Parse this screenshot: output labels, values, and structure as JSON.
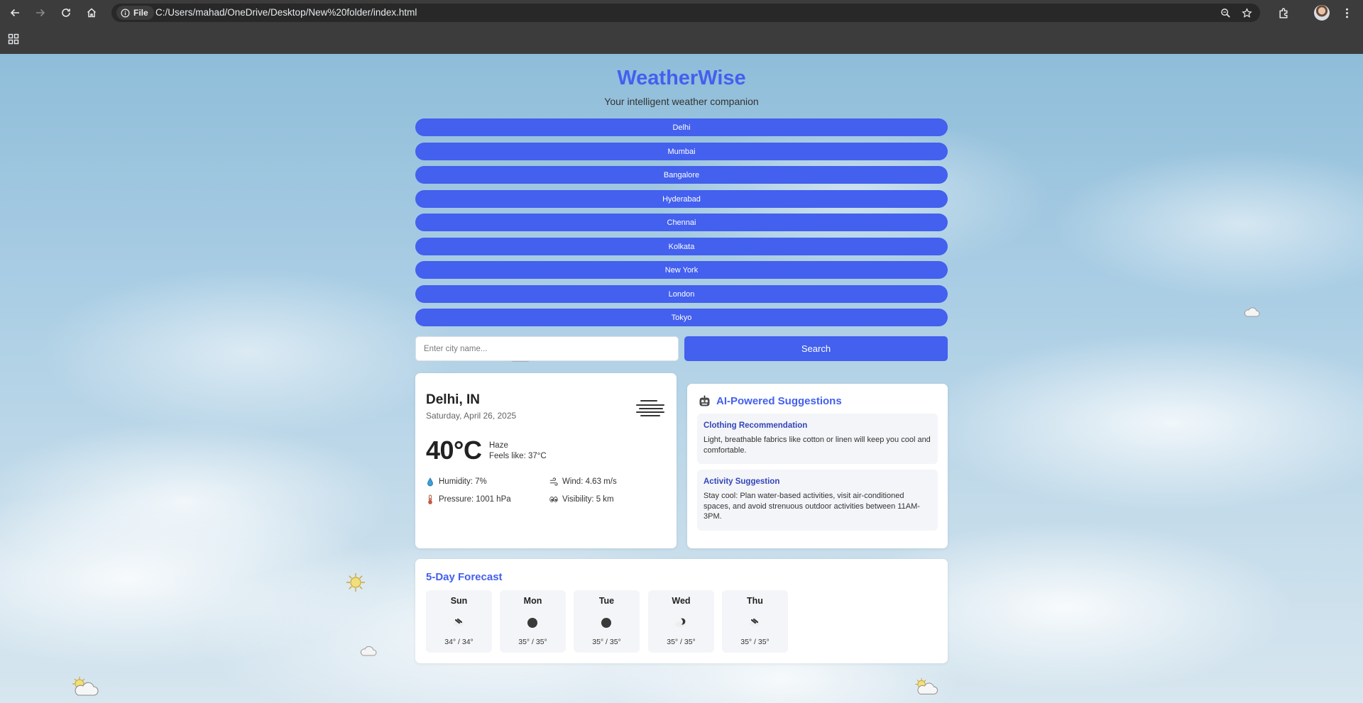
{
  "browser": {
    "url": "C:/Users/mahad/OneDrive/Desktop/New%20folder/index.html",
    "site_chip_label": "File"
  },
  "app": {
    "title": "WeatherWise",
    "subtitle": "Your intelligent weather companion"
  },
  "cities": [
    "Delhi",
    "Mumbai",
    "Bangalore",
    "Hyderabad",
    "Chennai",
    "Kolkata",
    "New York",
    "London",
    "Tokyo"
  ],
  "search": {
    "placeholder": "Enter city name...",
    "value": "",
    "button_label": "Search"
  },
  "current": {
    "location": "Delhi, IN",
    "date": "Saturday, April 26, 2025",
    "temperature": "40°C",
    "condition": "Haze",
    "feels_like": "Feels like: 37°C",
    "condition_icon": "haze-icon",
    "humidity": "Humidity: 7%",
    "wind": "Wind: 4.63 m/s",
    "pressure": "Pressure: 1001 hPa",
    "visibility": "Visibility: 5 km"
  },
  "ai": {
    "title": "AI-Powered Suggestions",
    "suggestions": [
      {
        "title": "Clothing Recommendation",
        "text": "Light, breathable fabrics like cotton or linen will keep you cool and comfortable."
      },
      {
        "title": "Activity Suggestion",
        "text": "Stay cool: Plan water-based activities, visit air-conditioned spaces, and avoid strenuous outdoor activities between 11AM-3PM."
      }
    ]
  },
  "forecast": {
    "title": "5-Day Forecast",
    "days": [
      {
        "day": "Sun",
        "temps": "34° / 34°",
        "icon": "scattered-clouds-night-icon"
      },
      {
        "day": "Mon",
        "temps": "35° / 35°",
        "icon": "moon-icon"
      },
      {
        "day": "Tue",
        "temps": "35° / 35°",
        "icon": "moon-icon"
      },
      {
        "day": "Wed",
        "temps": "35° / 35°",
        "icon": "partly-cloudy-night-icon"
      },
      {
        "day": "Thu",
        "temps": "35° / 35°",
        "icon": "scattered-clouds-night-icon"
      }
    ]
  },
  "colors": {
    "accent": "#4360ee",
    "accent_dark": "#3345b8",
    "chrome": "#3c3c3c"
  }
}
